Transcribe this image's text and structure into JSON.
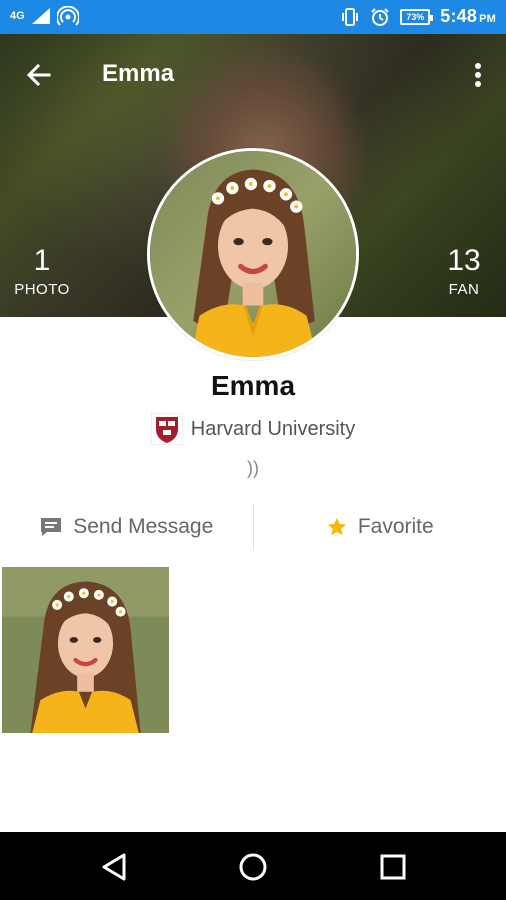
{
  "status_bar": {
    "network": "4G",
    "battery": "73",
    "time": "5:48",
    "ampm": "PM",
    "icons": [
      "signal-icon",
      "hotspot-icon",
      "vibrate-icon",
      "alarm-icon",
      "battery-icon"
    ]
  },
  "header": {
    "title": "Emma",
    "back_icon": "arrow-left-icon",
    "menu_icon": "more-vert-icon"
  },
  "stats": {
    "photos": {
      "count": "1",
      "label": "PHOTO"
    },
    "fans": {
      "count": "13",
      "label": "FAN"
    }
  },
  "profile": {
    "name": "Emma",
    "school": "Harvard University",
    "bio": "))"
  },
  "actions": {
    "message_label": "Send Message",
    "favorite_label": "Favorite"
  },
  "colors": {
    "status_bar": "#1e88e5",
    "star": "#f6b90c",
    "shirt": "#f4b41a"
  }
}
